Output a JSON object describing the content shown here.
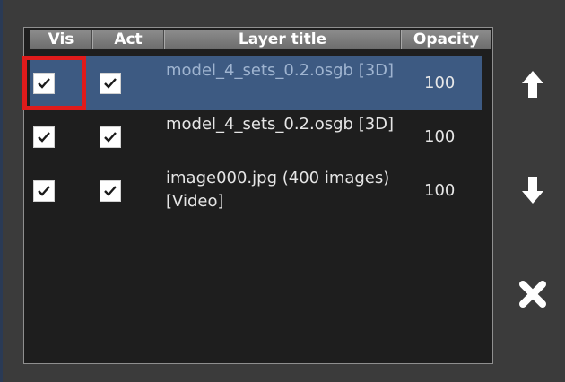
{
  "layer_table": {
    "columns": {
      "vis": "Vis",
      "act": "Act",
      "title": "Layer title",
      "opacity": "Opacity"
    },
    "rows": [
      {
        "title": "model_4_sets_0.2.osgb [3D]",
        "opacity": "100",
        "visible": true,
        "active": true,
        "selected": true
      },
      {
        "title": "model_4_sets_0.2.osgb [3D]",
        "opacity": "100",
        "visible": true,
        "active": true,
        "selected": false
      },
      {
        "title": "image000.jpg (400 images) [Video]",
        "opacity": "100",
        "visible": true,
        "active": true,
        "selected": false
      }
    ]
  },
  "side_buttons": {
    "move_up_icon": "arrow-up-icon",
    "move_down_icon": "arrow-down-icon",
    "remove_icon": "close-icon"
  },
  "colors": {
    "selection": "#3d5a82",
    "highlight": "#e01b1b",
    "panel_background": "#1e1e1e"
  }
}
